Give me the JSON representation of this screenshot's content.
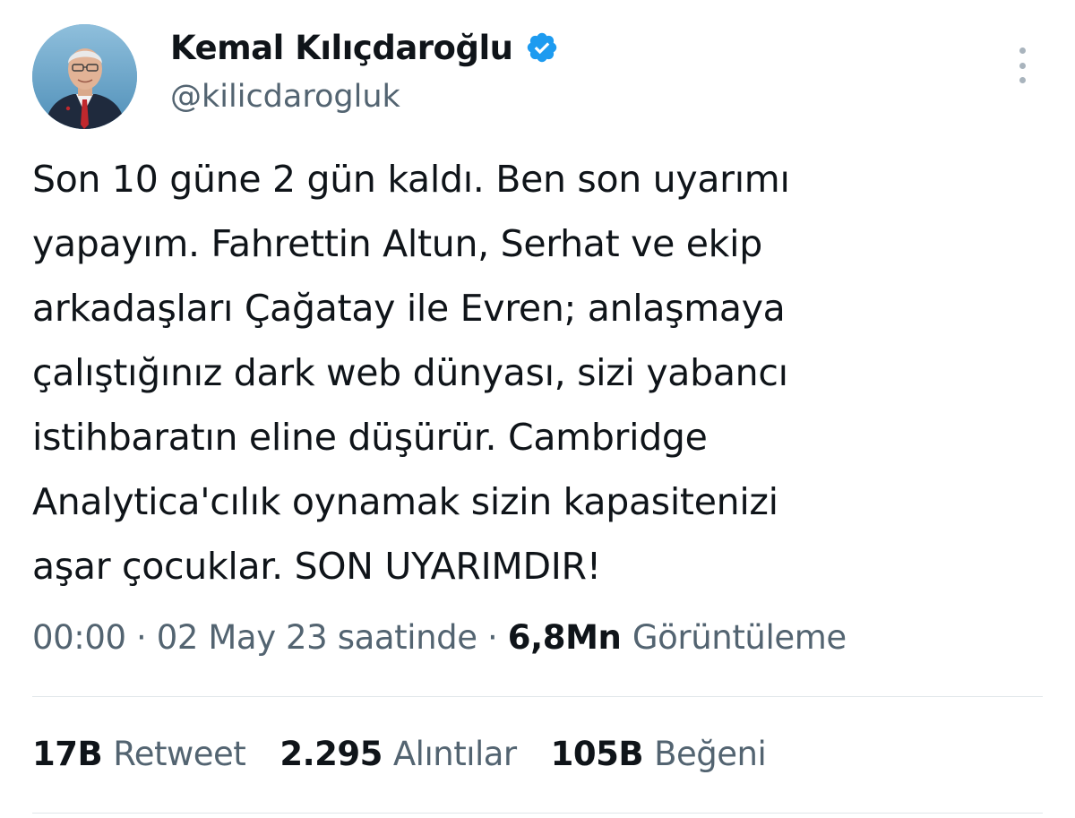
{
  "author": {
    "display_name": "Kemal Kılıçdaroğlu",
    "handle": "@kilicdarogluk",
    "verified": true,
    "verified_icon": "verified-badge-icon",
    "avatar_icon": "avatar-photo"
  },
  "tweet": {
    "lines": [
      "Son 10 güne 2 gün kaldı. Ben son uyarımı",
      "yapayım. Fahrettin Altun, Serhat ve ekip",
      "arkadaşları Çağatay ile Evren; anlaşmaya",
      "çalıştığınız dark web dünyası, sizi yabancı",
      "istihbaratın eline düşürür. Cambridge",
      "Analytica'cılık oynamak sizin kapasitenizi",
      "aşar çocuklar. SON UYARIMDIR!"
    ]
  },
  "meta": {
    "time": "00:00",
    "separator": "·",
    "date": "02 May 23 saatinde",
    "views_count": "6,8Mn",
    "views_label": "Görüntüleme"
  },
  "stats": [
    {
      "count": "17B",
      "label": "Retweet"
    },
    {
      "count": "2.295",
      "label": "Alıntılar"
    },
    {
      "count": "105B",
      "label": "Beğeni"
    }
  ],
  "colors": {
    "text_primary": "#0f1419",
    "text_secondary": "#536471",
    "verified_blue": "#1d9bf0",
    "divider": "#e1e6ea"
  },
  "icons": {
    "more": "more-options-icon"
  }
}
